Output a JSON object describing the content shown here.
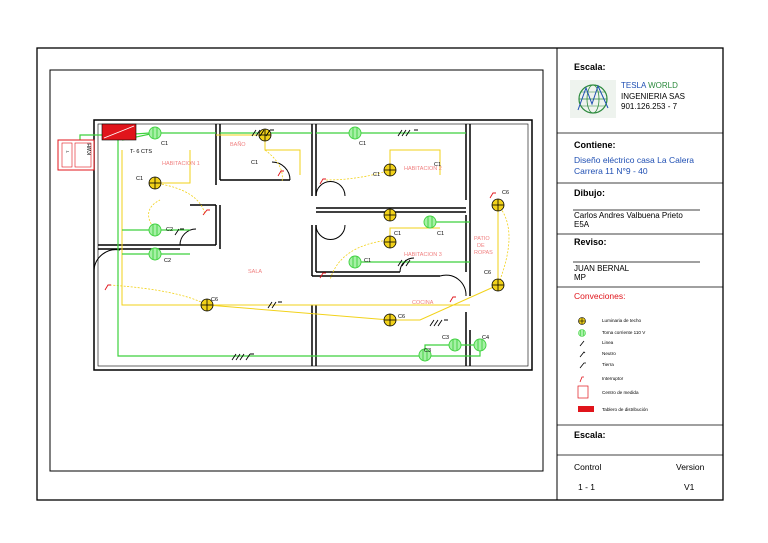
{
  "plan": {
    "rooms": {
      "banio": "BAÑO",
      "hab1": "HABITACION 1",
      "hab2": "HABITACION 2",
      "hab3": "HABITACION 3",
      "sala": "SALA",
      "cocina": "COCINA",
      "patio": [
        "PATIO",
        "DE",
        "ROPAS"
      ]
    },
    "panel_label": "T- 6 CTS",
    "meter": [
      "KWH",
      "T"
    ],
    "circuits": [
      "C1",
      "C2",
      "C3",
      "C4",
      "C5",
      "C6"
    ]
  },
  "title_block": {
    "escala_label": "Escala:",
    "company": {
      "name_a": "TESLA ",
      "name_b": "WORLD",
      "line2": "INGENIERIA SAS",
      "line3": "901.126.253 - 7"
    },
    "contiene_label": "Contiene:",
    "contiene_line1": "Diseño eléctrico casa La Calera",
    "contiene_line2": "Carrera 11 N°9 - 40",
    "dibujo_label": "Dibujo:",
    "dibujo_name": "Carlos Andres Valbuena Prieto",
    "dibujo_sub": "E5A",
    "reviso_label": "Reviso:",
    "reviso_name": "JUAN BERNAL",
    "reviso_sub": "MP",
    "convenciones_label": "Conveciones:",
    "legend": [
      "Luminaria de techo",
      "Toma corriente 110 V",
      "Linea",
      "Neutro",
      "Tierra",
      "Interruptor",
      "Centro de medida",
      "Tablero de distribución"
    ],
    "escala2_label": "Escala:",
    "control_label": "Control",
    "control_value": "1 - 1",
    "version_label": "Version",
    "version_value": "V1"
  },
  "colors": {
    "wire_green": "#3dd13d",
    "wire_yellow": "#f2d21a",
    "accent_red": "#e0141b",
    "title_blue": "#1f4fb3"
  }
}
